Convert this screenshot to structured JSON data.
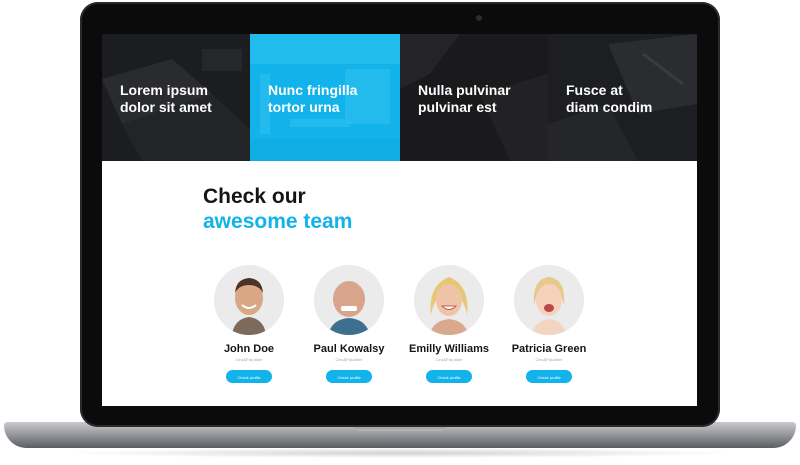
{
  "hero_tiles": [
    {
      "caption": "Lorem ipsum\ndolor sit amet",
      "icon": "laptop-desk-photo"
    },
    {
      "caption": "Nunc fringilla\ntortor urna",
      "icon": "office-interior-photo"
    },
    {
      "caption": "Nulla pulvinar\npulvinar est",
      "icon": "keyboard-desk-photo"
    },
    {
      "caption": "Fusce at\ndiam condim",
      "icon": "notebook-pen-photo"
    }
  ],
  "team": {
    "heading_line1": "Check our",
    "heading_line2": "awesome team",
    "members": [
      {
        "name": "John Doe",
        "role": "Ceo&Founder",
        "button": "Check profile"
      },
      {
        "name": "Paul Kowalsy",
        "role": "Ceo&Founder",
        "button": "Check profile"
      },
      {
        "name": "Emilly Williams",
        "role": "Ceo&Founder",
        "button": "Check profile"
      },
      {
        "name": "Patricia Green",
        "role": "Ceo&Founder",
        "button": "Check profile"
      }
    ]
  },
  "colors": {
    "accent": "#11b3ea",
    "hero_dark": "#1b1b1d",
    "heading_dark": "#151515",
    "avatar_bg": "#ebebeb"
  }
}
